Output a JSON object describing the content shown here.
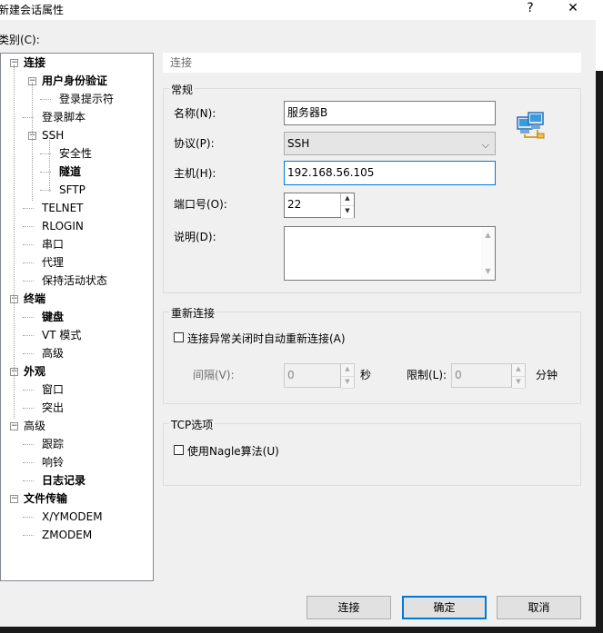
{
  "window": {
    "title": "新建会话属性",
    "help_icon": "?",
    "close_icon": "✕"
  },
  "category_label": "类别(C):",
  "tree": [
    {
      "label": "连接",
      "bold": true,
      "expander": "−",
      "level": 0
    },
    {
      "label": "用户身份验证",
      "bold": true,
      "expander": "−",
      "level": 1
    },
    {
      "label": "登录提示符",
      "bold": false,
      "level": 2
    },
    {
      "label": "登录脚本",
      "bold": false,
      "level": 1
    },
    {
      "label": "SSH",
      "bold": false,
      "expander": "−",
      "level": 1
    },
    {
      "label": "安全性",
      "bold": false,
      "level": 2
    },
    {
      "label": "隧道",
      "bold": true,
      "level": 2
    },
    {
      "label": "SFTP",
      "bold": false,
      "level": 2
    },
    {
      "label": "TELNET",
      "bold": false,
      "level": 1
    },
    {
      "label": "RLOGIN",
      "bold": false,
      "level": 1
    },
    {
      "label": "串口",
      "bold": false,
      "level": 1
    },
    {
      "label": "代理",
      "bold": false,
      "level": 1
    },
    {
      "label": "保持活动状态",
      "bold": false,
      "level": 1
    },
    {
      "label": "终端",
      "bold": true,
      "expander": "−",
      "level": 0
    },
    {
      "label": "键盘",
      "bold": true,
      "level": 1
    },
    {
      "label": "VT 模式",
      "bold": false,
      "level": 1
    },
    {
      "label": "高级",
      "bold": false,
      "level": 1
    },
    {
      "label": "外观",
      "bold": true,
      "expander": "−",
      "level": 0
    },
    {
      "label": "窗口",
      "bold": false,
      "level": 1
    },
    {
      "label": "突出",
      "bold": false,
      "level": 1
    },
    {
      "label": "高级",
      "bold": false,
      "expander": "−",
      "level": 0
    },
    {
      "label": "跟踪",
      "bold": false,
      "level": 1
    },
    {
      "label": "响铃",
      "bold": false,
      "level": 1
    },
    {
      "label": "日志记录",
      "bold": true,
      "level": 1
    },
    {
      "label": "文件传输",
      "bold": true,
      "expander": "−",
      "level": 0
    },
    {
      "label": "X/YMODEM",
      "bold": false,
      "level": 1
    },
    {
      "label": "ZMODEM",
      "bold": false,
      "level": 1
    }
  ],
  "panel": {
    "header": "连接",
    "general": {
      "title": "常规",
      "name_label": "名称(N):",
      "name_value": "服务器B",
      "protocol_label": "协议(P):",
      "protocol_value": "SSH",
      "host_label": "主机(H):",
      "host_value": "192.168.56.105",
      "port_label": "端口号(O):",
      "port_value": "22",
      "desc_label": "说明(D):",
      "desc_value": ""
    },
    "reconnect": {
      "title": "重新连接",
      "checkbox_label": "连接异常关闭时自动重新连接(A)",
      "checked": false,
      "interval_label": "间隔(V):",
      "interval_value": "0",
      "interval_unit": "秒",
      "limit_label": "限制(L):",
      "limit_value": "0",
      "limit_unit": "分钟"
    },
    "tcp": {
      "title": "TCP选项",
      "checkbox_label": "使用Nagle算法(U)",
      "checked": false
    }
  },
  "buttons": {
    "connect": "连接",
    "ok": "确定",
    "cancel": "取消"
  }
}
